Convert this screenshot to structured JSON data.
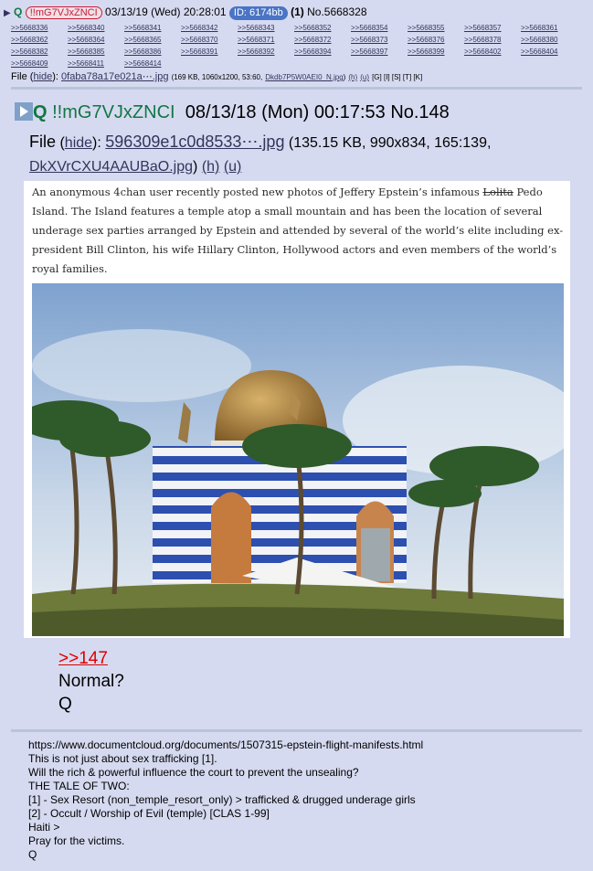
{
  "post": {
    "q_label": "Q",
    "tripcode": "!!mG7VJxZNCI",
    "datetime": "03/13/19 (Wed) 20:28:01",
    "id_badge": "ID: 6174bb",
    "post_count": "(1)",
    "post_number": "No.5668328",
    "backlinks": [
      ">>5668336",
      ">>5668340",
      ">>5668341",
      ">>5668342",
      ">>5668343",
      ">>5668352",
      ">>5668354",
      ">>5668355",
      ">>5668357",
      ">>5668361",
      ">>5668362",
      ">>5668364",
      ">>5668365",
      ">>5668370",
      ">>5668371",
      ">>5668372",
      ">>5668373",
      ">>5668376",
      ">>5668378",
      ">>5668380",
      ">>5668382",
      ">>5668385",
      ">>5668386",
      ">>5668391",
      ">>5668392",
      ">>5668394",
      ">>5668397",
      ">>5668399",
      ">>5668402",
      ">>5668404",
      ">>5668409",
      ">>5668411",
      ">>5668414"
    ],
    "file_label": "File",
    "hide_label": "hide",
    "file_name": "0faba78a17e021a⋯.jpg",
    "file_meta": "(169 KB, 1060x1200, 53:60,",
    "file_orig": "Dkdb7P5W0AEI0_N.jpg",
    "file_meta_end": ")",
    "h_label": "(h)",
    "u_label": "(u)",
    "extra_links": "[G] [I] [S] [T] [K]"
  },
  "inner": {
    "q_label": "Q",
    "tripcode": "!!mG7VJxZNCI",
    "datetime": "08/13/18 (Mon) 00:17:53",
    "post_number": "No.148",
    "file_label": "File",
    "hide_label": "hide",
    "file_name": "596309e1c0d8533⋯.jpg",
    "file_meta": "(135.15 KB, 990x834, 165:139,",
    "file_orig": "DkXVrCXU4AAUBaO.jpg",
    "h_label": "(h)",
    "u_label": "(u)",
    "article_part1": "An anonymous 4chan user recently posted new photos of Jeffery Epstein’s infamous ",
    "article_struck": "Lolita",
    "article_part2": " Pedo Island. The Island features a temple atop a small mountain and has been the location of several underage sex parties arranged by Epstein and attended by several of the world’s elite including ex-president Bill Clinton, his wife Hillary Clinton, Hollywood actors and even members of the world’s royal families.",
    "reply_link": ">>147",
    "reply_line1": "Normal?",
    "reply_line2": "Q"
  },
  "message": [
    "https://www.documentcloud.org/documents/1507315-epstein-flight-manifests.html",
    "This is not just about sex trafficking [1].",
    "Will the rich & powerful influence the court to prevent the unsealing?",
    "THE TALE OF TWO:",
    "[1] - Sex Resort (non_temple_resort_only) > trafficked & drugged underage girls",
    "[2] - Occult / Worship of Evil (temple) [CLAS 1-99]",
    "Haiti >",
    "Pray for the victims.",
    "Q"
  ],
  "colors": {
    "background": "#d6daf0",
    "trip_red": "#c41e3a",
    "trip_green": "#117743",
    "id_badge": "#4a74c4",
    "link": "#34345c"
  }
}
